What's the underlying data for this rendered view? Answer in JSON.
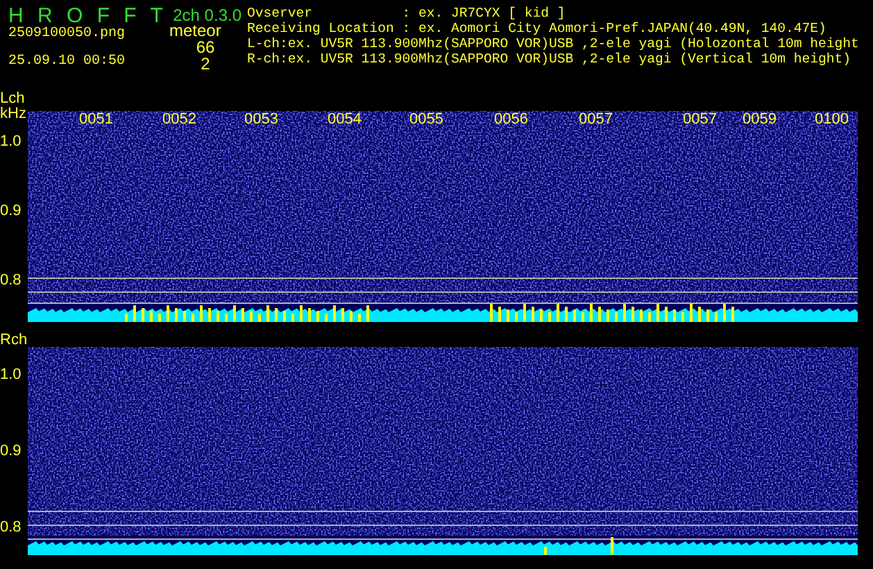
{
  "header": {
    "app_name": "H R O F F T",
    "version": "2ch 0.3.0",
    "filename": "2509100050.png",
    "datetime": "25.09.10 00:50",
    "meteor_label": "meteor",
    "l_count": "66",
    "r_count": "2"
  },
  "info_lines": [
    "Ovserver           : ex. JR7CYX [ kid ]",
    "Receiving Location : ex. Aomori City Aomori-Pref.JAPAN(40.49N, 140.47E)",
    "L-ch:ex. UV5R 113.900Mhz(SAPPORO VOR)USB ,2-ele yagi (Holozontal 10m height",
    "R-ch:ex. UV5R 113.900Mhz(SAPPORO VOR)USB ,2-ele yagi (Vertical 10m height)"
  ],
  "channels": [
    {
      "label": "Lch",
      "unit": "kHz",
      "yticks": [
        "1.0",
        "0.9",
        "0.8"
      ],
      "time_labels": [
        "0051",
        "0052",
        "0053",
        "0054",
        "0055",
        "0056",
        "0057",
        "0057",
        "0059",
        "0100"
      ]
    },
    {
      "label": "Rch",
      "yticks": [
        "1.0",
        "0.9",
        "0.8"
      ]
    }
  ]
}
